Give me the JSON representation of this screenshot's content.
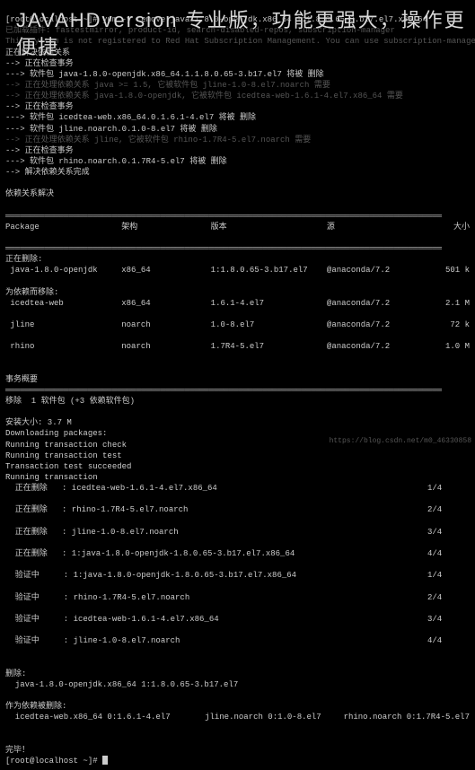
{
  "overlay": "JAVAHDversion 专业版，功能更强大，操作更便捷",
  "prompt1": "[root@localhost ~]# ",
  "cmd": "yum -y remove java-1.8.0-openjdk.x86_64 1:1.8.0.65-3.b17.el7.x86_64",
  "plugins": "已加载插件: fastestmirror, product-id, search-disabled-repos, subscription-manager",
  "subscript": "This system is not registered to Red Hat Subscription Management. You can use subscription-manager to register.",
  "check": "正在解决依赖关系",
  "resolve1": "--> 正在检查事务",
  "r1": "---> 软件包 java-1.8.0-openjdk.x86_64.1.1.8.0.65-3.b17.el7 将被 删除",
  "r2": "--> 正在处理依赖关系 java >= 1.5, 它被软件包 jline-1.0-8.el7.noarch 需要",
  "r3": "--> 正在处理依赖关系 java-1.8.0-openjdk, 它被软件包 icedtea-web-1.6.1-4.el7.x86_64 需要",
  "r4": "--> 正在检查事务",
  "r5": "---> 软件包 icedtea-web.x86_64.0.1.6.1-4.el7 将被 删除",
  "r6": "---> 软件包 jline.noarch.0.1.0-8.el7 将被 删除",
  "r7": "--> 正在处理依赖关系 jline, 它被软件包 rhino-1.7R4-5.el7.noarch 需要",
  "r8": "--> 正在检查事务",
  "r9": "---> 软件包 rhino.noarch.0.1.7R4-5.el7 将被 删除",
  "r10": "--> 解决依赖关系完成",
  "depres": "依赖关系解决",
  "hdrs": {
    "p": "Package",
    "a": "架构",
    "v": "版本",
    "r": "源",
    "s": "大小"
  },
  "removing": "正在删除:",
  "rows": [
    {
      "p": " java-1.8.0-openjdk",
      "a": "x86_64",
      "v": "1:1.8.0.65-3.b17.el7",
      "r": "@anaconda/7.2",
      "s": "501 k"
    }
  ],
  "depremove": "为依赖而移除:",
  "deps": [
    {
      "p": " icedtea-web",
      "a": "x86_64",
      "v": "1.6.1-4.el7",
      "r": "@anaconda/7.2",
      "s": "2.1 M"
    },
    {
      "p": " jline",
      "a": "noarch",
      "v": "1.0-8.el7",
      "r": "@anaconda/7.2",
      "s": "72 k"
    },
    {
      "p": " rhino",
      "a": "noarch",
      "v": "1.7R4-5.el7",
      "r": "@anaconda/7.2",
      "s": "1.0 M"
    }
  ],
  "summary": "事务概要",
  "removeLine": "移除  1 软件包 (+3 依赖软件包)",
  "instSize": "安装大小: 3.7 M",
  "dl": "Downloading packages:",
  "tc": "Running transaction check",
  "tt": "Running transaction test",
  "ts": "Transaction test succeeded",
  "rt": "Running transaction",
  "trans": [
    {
      "l": "  正在删除   : icedtea-web-1.6.1-4.el7.x86_64",
      "n": "1/4"
    },
    {
      "l": "  正在删除   : rhino-1.7R4-5.el7.noarch",
      "n": "2/4"
    },
    {
      "l": "  正在删除   : jline-1.0-8.el7.noarch",
      "n": "3/4"
    },
    {
      "l": "  正在删除   : 1:java-1.8.0-openjdk-1.8.0.65-3.b17.el7.x86_64",
      "n": "4/4"
    },
    {
      "l": "  验证中     : 1:java-1.8.0-openjdk-1.8.0.65-3.b17.el7.x86_64",
      "n": "1/4"
    },
    {
      "l": "  验证中     : rhino-1.7R4-5.el7.noarch",
      "n": "2/4"
    },
    {
      "l": "  验证中     : icedtea-web-1.6.1-4.el7.x86_64",
      "n": "3/4"
    },
    {
      "l": "  验证中     : jline-1.0-8.el7.noarch",
      "n": "4/4"
    }
  ],
  "removed": "删除:",
  "removedPkg": "  java-1.8.0-openjdk.x86_64 1:1.8.0.65-3.b17.el7",
  "depRemoved": "作为依赖被删除:",
  "depRow": {
    "a": "  icedtea-web.x86_64 0:1.6.1-4.el7",
    "b": "jline.noarch 0:1.0-8.el7",
    "c": "rhino.noarch 0:1.7R4-5.el7"
  },
  "done": "完毕！",
  "footer": "https://blog.csdn.net/m0_46330858"
}
